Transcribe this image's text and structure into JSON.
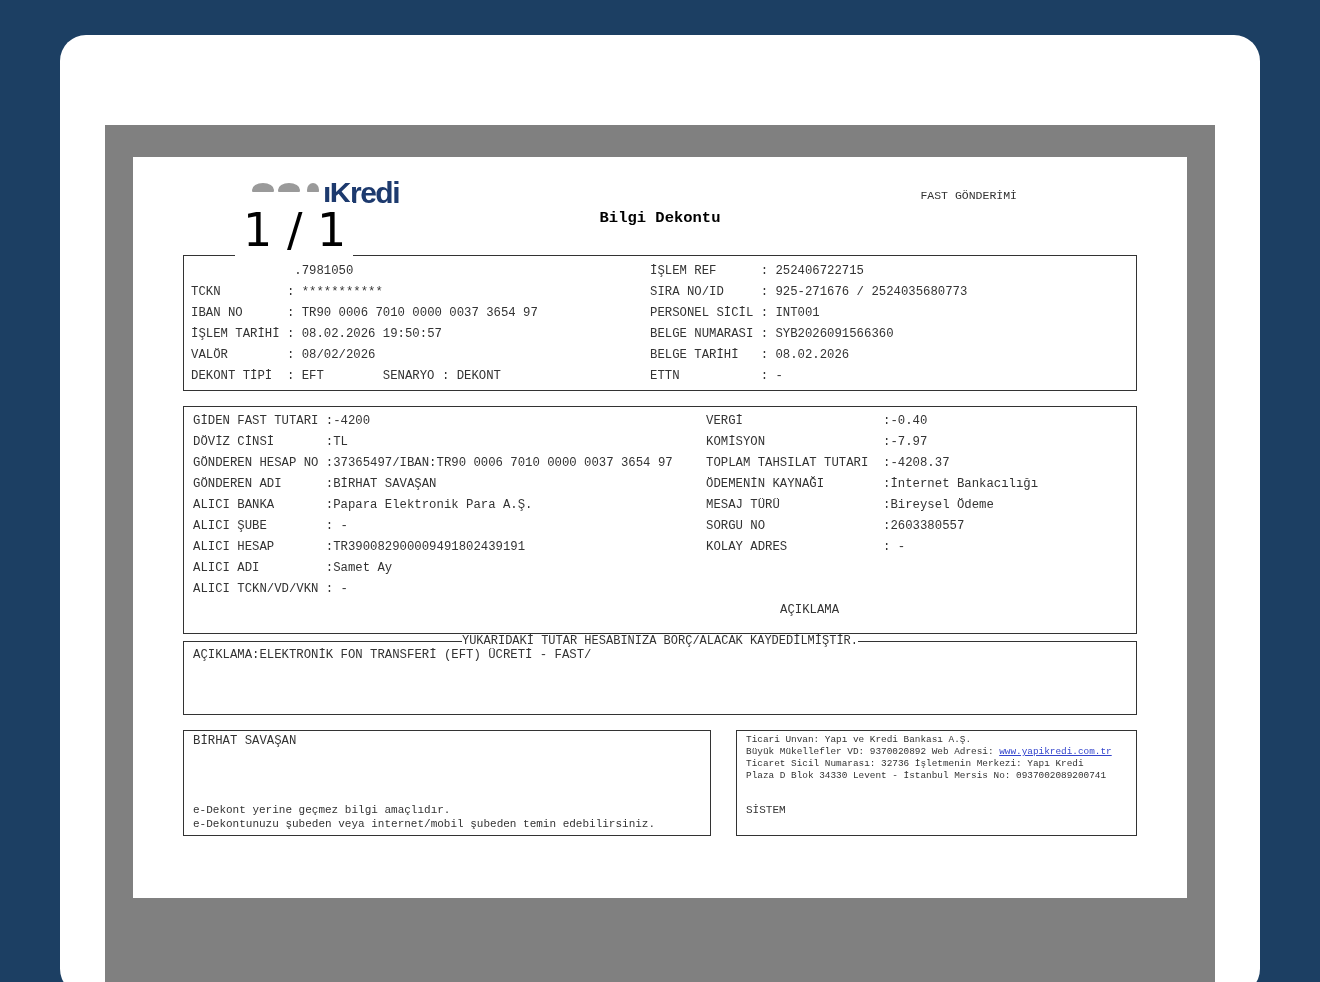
{
  "viewer": {
    "page_indicator": "1 / 1"
  },
  "document": {
    "logo": "ıKredi",
    "title": "Bilgi Dekontu",
    "type": "FAST GÖNDERİMİ",
    "info_left": [
      {
        "value": ".7981050"
      },
      {
        "label": "TCKN",
        "value": ": ***********"
      },
      {
        "label": "IBAN NO",
        "value": ": TR90 0006 7010 0000 0037 3654 97"
      },
      {
        "label": "İŞLEM TARİHİ",
        "value": ": 08.02.2026 19:50:57"
      },
      {
        "label": "VALÖR",
        "value": ": 08/02/2026"
      },
      {
        "label": "DEKONT TİPİ",
        "value": ": EFT",
        "extra": {
          "label": "SENARYO",
          "value": ": DEKONT"
        }
      }
    ],
    "info_right": [
      {
        "label": "İŞLEM REF",
        "value": ": 252406722715"
      },
      {
        "label": "SIRA NO/ID",
        "value": ": 925-271676 / 2524035680773"
      },
      {
        "label": "PERSONEL SİCİL",
        "value": ": INT001"
      },
      {
        "label": "BELGE NUMARASI",
        "value": ": SYB2026091566360"
      },
      {
        "label": "BELGE TARİHİ",
        "value": ": 08.02.2026"
      },
      {
        "label": "ETTN",
        "value": ": -"
      }
    ],
    "details_left": [
      {
        "label": "GİDEN FAST TUTARI",
        "value": ":-4200"
      },
      {
        "label": "DÖVİZ CİNSİ",
        "value": ":TL"
      },
      {
        "label": "GÖNDEREN HESAP NO",
        "value": ":37365497/IBAN:TR90 0006 7010 0000 0037 3654 97"
      },
      {
        "label": "GÖNDEREN ADI",
        "value": ":BİRHAT SAVAŞAN"
      },
      {
        "label": "ALICI BANKA",
        "value": ":Papara Elektronik Para A.Ş."
      },
      {
        "label": "ALICI ŞUBE",
        "value": ": -"
      },
      {
        "label": "ALICI HESAP",
        "value": ":TR390082900009491802439191"
      },
      {
        "label": "ALICI ADI",
        "value": ":Samet Ay"
      },
      {
        "label": "ALICI TCKN/VD/VKN",
        "value": ": -"
      }
    ],
    "details_right": [
      {
        "label": "VERGİ",
        "value": ":-0.40"
      },
      {
        "label": "KOMİSYON",
        "value": ":-7.97"
      },
      {
        "label": "TOPLAM TAHSILAT TUTARI",
        "value": ":-4208.37"
      },
      {
        "label": "ÖDEMENİN KAYNAĞI",
        "value": ":İnternet Bankacılığı"
      },
      {
        "label": "MESAJ TÜRÜ",
        "value": ":Bireysel Ödeme"
      },
      {
        "label": "SORGU NO",
        "value": ":2603380557"
      },
      {
        "label": "KOLAY ADRES",
        "value": ": -"
      }
    ],
    "description_heading": "AÇIKLAMA",
    "notice": "YUKARIDAKİ TUTAR HESABINIZA BORÇ/ALACAK KAYDEDİLMİŞTİR.",
    "description": "AÇIKLAMA:ELEKTRONİK FON TRANSFERİ (EFT) ÜCRETİ - FAST/",
    "customer": {
      "name": "BİRHAT SAVAŞAN",
      "notes": [
        "e-Dekont yerine geçmez bilgi amaçlıdır.",
        "e-Dekontunuzu şubeden veya internet/mobil şubeden temin edebilirsiniz."
      ]
    },
    "bank": {
      "lines": [
        {
          "text": "Ticari Unvan: Yapı ve Kredi Bankası A.Ş."
        },
        {
          "text": "Büyük Mükellefler VD: 9370020892 Web Adresi: ",
          "link": "www.yapikredi.com.tr"
        },
        {
          "text": "Ticaret Sicil Numarası: 32736 İşletmenin Merkezi: Yapı Kredi"
        },
        {
          "text": "Plaza D Blok 34330 Levent - İstanbul Mersis No: 0937002089200741"
        }
      ],
      "signature": "SİSTEM"
    }
  }
}
